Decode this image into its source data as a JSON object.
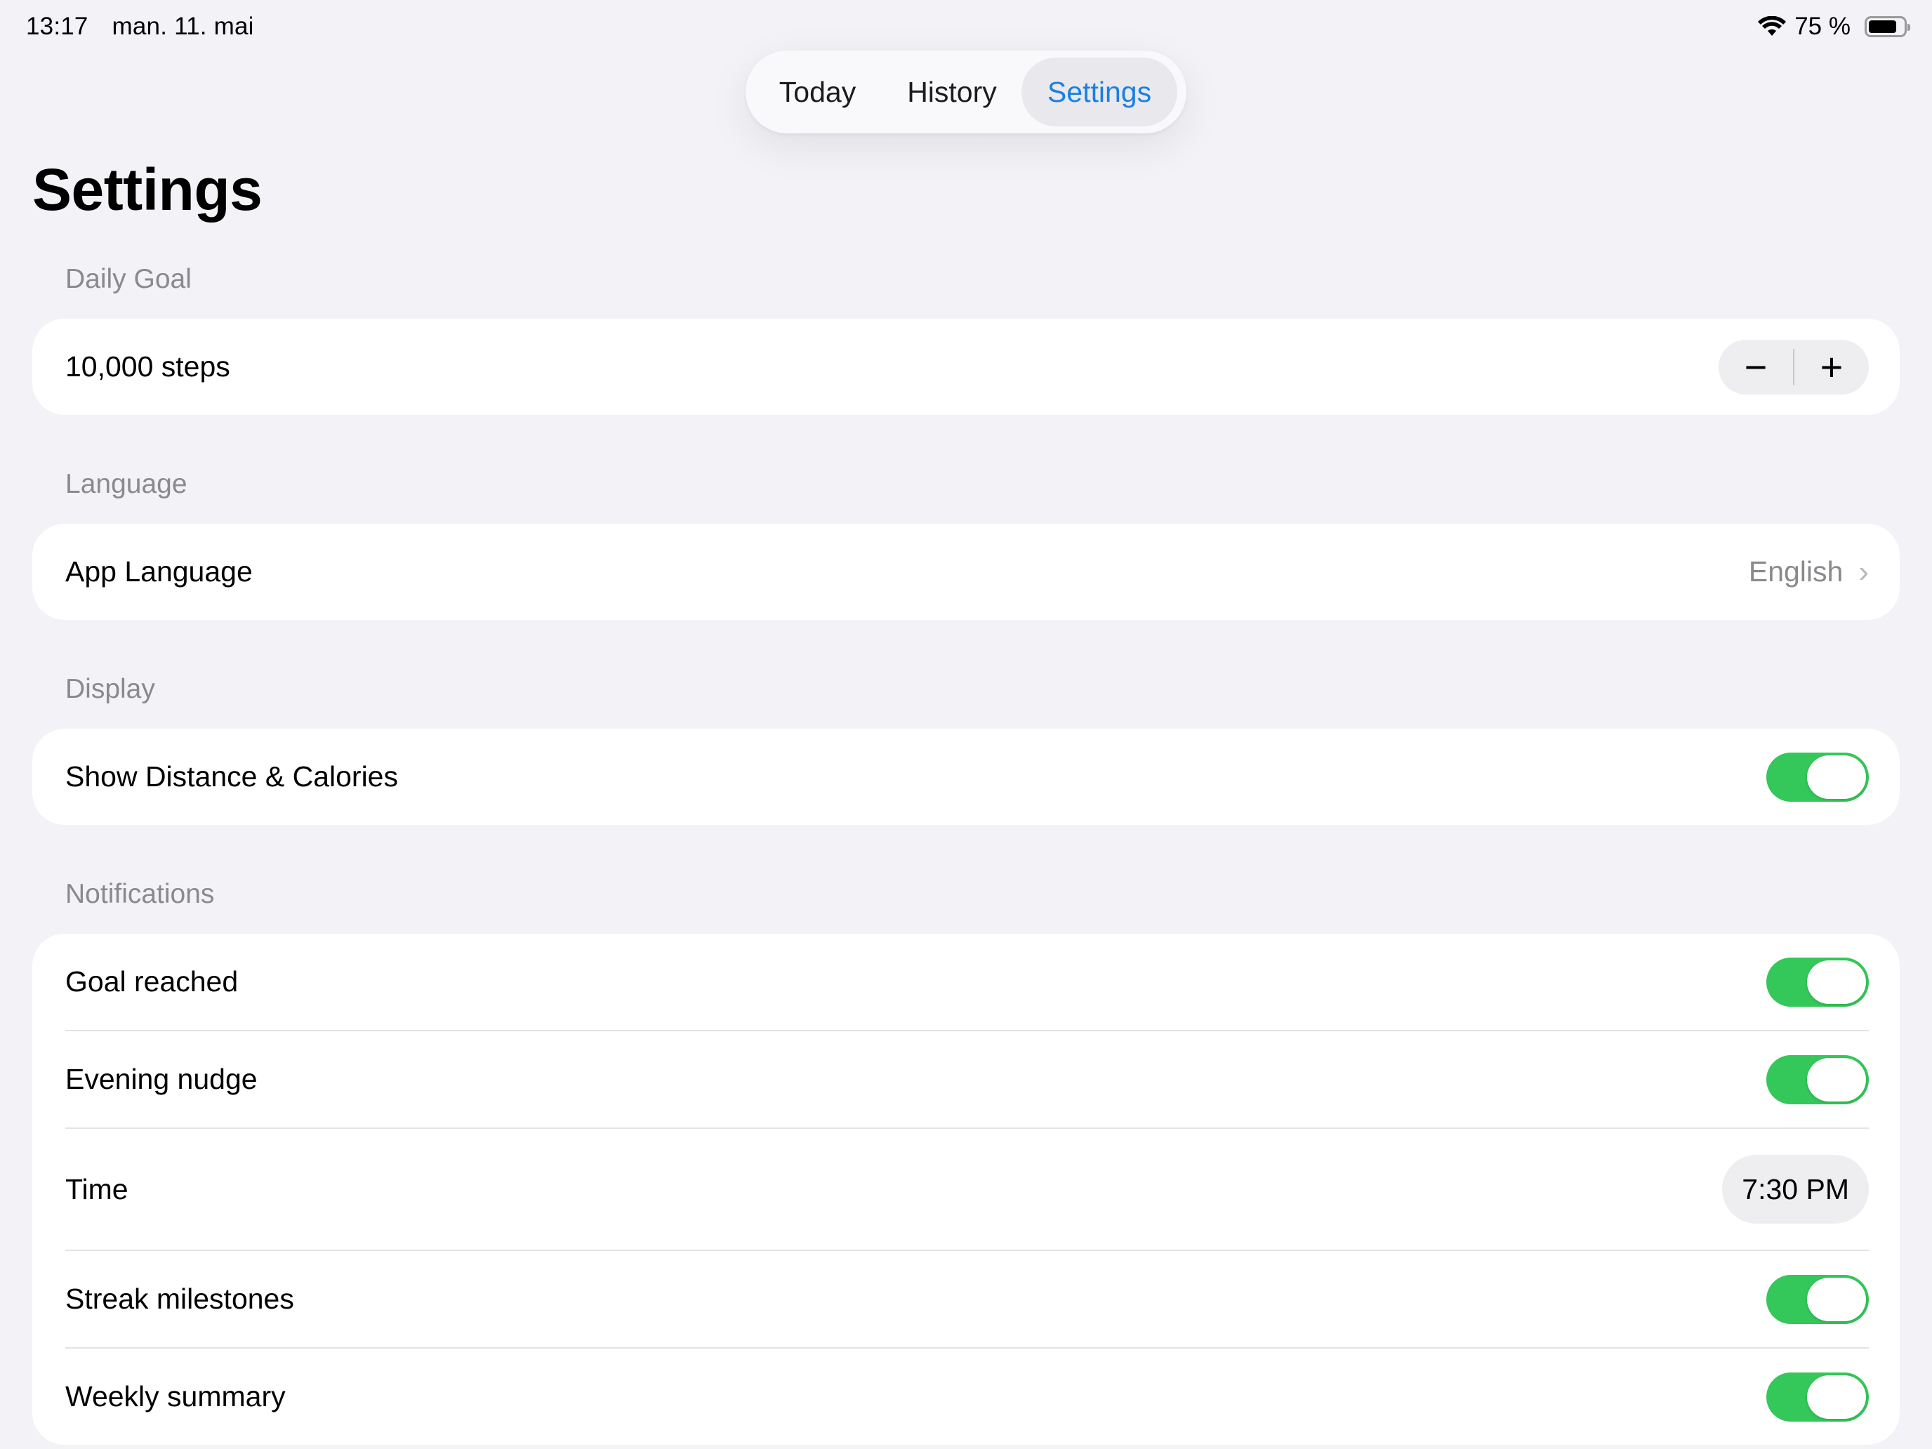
{
  "status_bar": {
    "time": "13:17",
    "date": "man. 11. mai",
    "battery_text": "75 %",
    "battery_level": 0.75,
    "wifi_icon": "wifi-icon",
    "battery_icon": "battery-icon"
  },
  "tabs": [
    {
      "label": "Today",
      "selected": false
    },
    {
      "label": "History",
      "selected": false
    },
    {
      "label": "Settings",
      "selected": true
    }
  ],
  "page_title": "Settings",
  "sections": {
    "daily_goal": {
      "header": "Daily Goal",
      "steps_label": "10,000 steps",
      "decrement": "−",
      "increment": "+"
    },
    "language": {
      "header": "Language",
      "row_label": "App Language",
      "value": "English",
      "chevron": "›"
    },
    "display": {
      "header": "Display",
      "row_label": "Show Distance & Calories",
      "toggle_on": true
    },
    "notifications": {
      "header": "Notifications",
      "goal_reached": {
        "label": "Goal reached",
        "toggle_on": true
      },
      "evening_nudge": {
        "label": "Evening nudge",
        "toggle_on": true
      },
      "time": {
        "label": "Time",
        "value": "7:30 PM"
      },
      "streak_milestones": {
        "label": "Streak milestones",
        "toggle_on": true
      },
      "weekly_summary": {
        "label": "Weekly summary",
        "toggle_on": true
      }
    }
  },
  "colors": {
    "accent": "#1a7fe0",
    "toggle_on": "#34c759",
    "background": "#f2f2f7"
  }
}
